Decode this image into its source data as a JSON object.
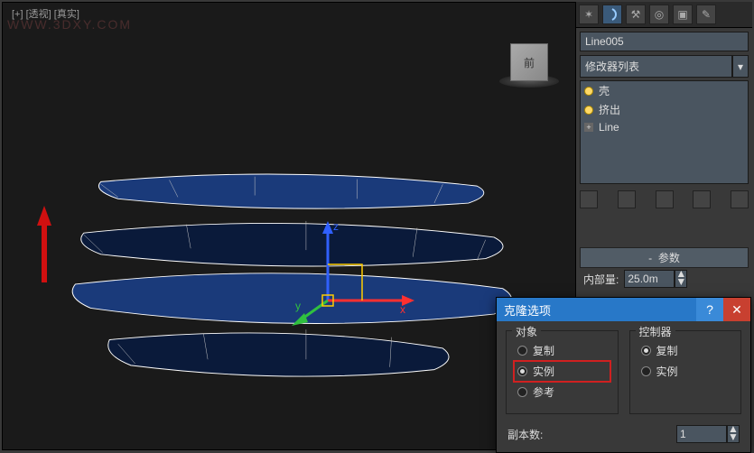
{
  "viewport": {
    "label": "[+] [透视] [真实]",
    "watermark": "WWW.3DXY.COM",
    "cube_face": "前"
  },
  "panel": {
    "object_name": "Line005",
    "modifier_dropdown": "修改器列表",
    "stack": [
      "壳",
      "挤出",
      "Line"
    ],
    "rollout_params": "参数",
    "inner_label": "内部量:",
    "inner_value": "25.0m"
  },
  "dialog": {
    "title": "克隆选项",
    "group_object": "对象",
    "group_controller": "控制器",
    "opt_copy": "复制",
    "opt_instance": "实例",
    "opt_reference": "参考",
    "copies_label": "副本数:",
    "copies_value": "1"
  }
}
